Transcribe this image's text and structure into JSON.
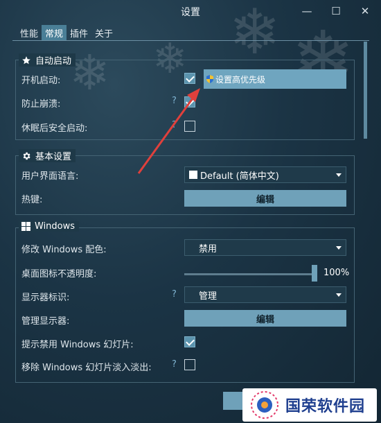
{
  "window": {
    "title": "设置",
    "controls": {
      "minimize": "—",
      "maximize": "☐",
      "close": "✕"
    }
  },
  "tabs": [
    "性能",
    "常规",
    "插件",
    "关于"
  ],
  "active_tab": "常规",
  "sections": {
    "autostart": {
      "title": "自动启动",
      "icon": "star-icon",
      "items": [
        {
          "label": "开机启动:",
          "checked": true
        },
        {
          "label": "防止崩溃:",
          "checked": true,
          "help": "?"
        },
        {
          "label": "休眠后安全启动:",
          "checked": false,
          "help": "?"
        }
      ],
      "popup": "设置高优先级"
    },
    "basic": {
      "title": "基本设置",
      "icon": "gear-icon",
      "language_label": "用户界面语言:",
      "language_value": "Default (简体中文)",
      "hotkey_label": "热键:",
      "hotkey_button": "编辑"
    },
    "windows": {
      "title": "Windows",
      "icon": "windows-logo-icon",
      "color_label": "修改 Windows 配色:",
      "color_value": "禁用",
      "opacity_label": "桌面图标不透明度:",
      "opacity_value": "100%",
      "opacity_level": 1.0,
      "monitor_id_label": "显示器标识:",
      "monitor_id_help": "?",
      "monitor_id_value": "管理",
      "manage_monitors_label": "管理显示器:",
      "manage_monitors_button": "编辑",
      "slideshow_hint_label": "提示禁用 Windows 幻灯片:",
      "slideshow_hint_checked": true,
      "slideshow_fade_label": "移除 Windows 幻灯片淡入淡出:",
      "slideshow_fade_help": "?",
      "slideshow_fade_checked": false
    }
  },
  "watermark": {
    "text": "国荣软件园"
  },
  "colors": {
    "accent": "#6fa1b9",
    "arrow": "#e0403c",
    "background": "#1b3445"
  }
}
